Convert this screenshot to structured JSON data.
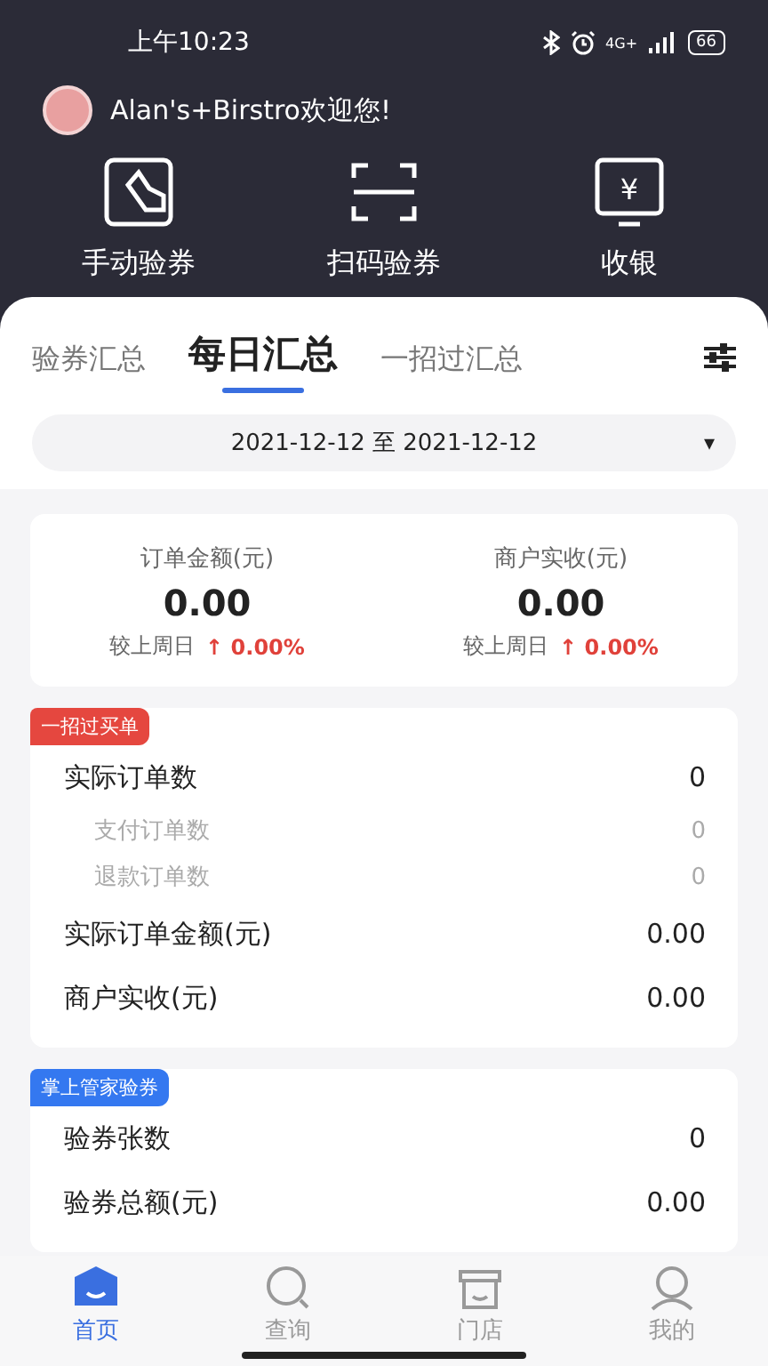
{
  "status_bar": {
    "time": "上午10:23",
    "battery": "66",
    "network": "4G+"
  },
  "greeting": "Alan's+Birstro欢迎您!",
  "actions": [
    {
      "kind": "hand",
      "label": "手动验券"
    },
    {
      "kind": "scan",
      "label": "扫码验券"
    },
    {
      "kind": "cash",
      "label": "收银",
      "glyph": "¥"
    }
  ],
  "tabs": [
    {
      "label": "验券汇总",
      "selected": false
    },
    {
      "label": "每日汇总",
      "selected": true
    },
    {
      "label": "一招过汇总",
      "selected": false
    }
  ],
  "date_range": {
    "value": "2021-12-12 至 2021-12-12",
    "caret": "▾"
  },
  "summary": [
    {
      "label": "订单金额(元)",
      "value": "0.00",
      "compare": "较上周日",
      "arrow": "↑",
      "change": "0.00%"
    },
    {
      "label": "商户实收(元)",
      "value": "0.00",
      "compare": "较上周日",
      "arrow": "↑",
      "change": "0.00%"
    }
  ],
  "sections": [
    {
      "tag": "一招过买单",
      "color": "#e5473f",
      "rows": [
        {
          "kind": "main",
          "label": "实际订单数",
          "value": "0"
        },
        {
          "kind": "sub",
          "label": "支付订单数",
          "value": "0"
        },
        {
          "kind": "sub",
          "label": "退款订单数",
          "value": "0"
        },
        {
          "kind": "main",
          "label": "实际订单金额(元)",
          "value": "0.00"
        },
        {
          "kind": "main",
          "label": "商户实收(元)",
          "value": "0.00"
        }
      ]
    },
    {
      "tag": "掌上管家验券",
      "color": "#3478f0",
      "rows": [
        {
          "kind": "main",
          "label": "验券张数",
          "value": "0"
        },
        {
          "kind": "main",
          "label": "验券总额(元)",
          "value": "0.00"
        }
      ]
    }
  ],
  "bottom_nav": [
    {
      "kind": "home",
      "label": "首页",
      "selected": true
    },
    {
      "kind": "search",
      "label": "查询",
      "selected": false
    },
    {
      "kind": "store",
      "label": "门店",
      "selected": false
    },
    {
      "kind": "user",
      "label": "我的",
      "selected": false
    }
  ]
}
